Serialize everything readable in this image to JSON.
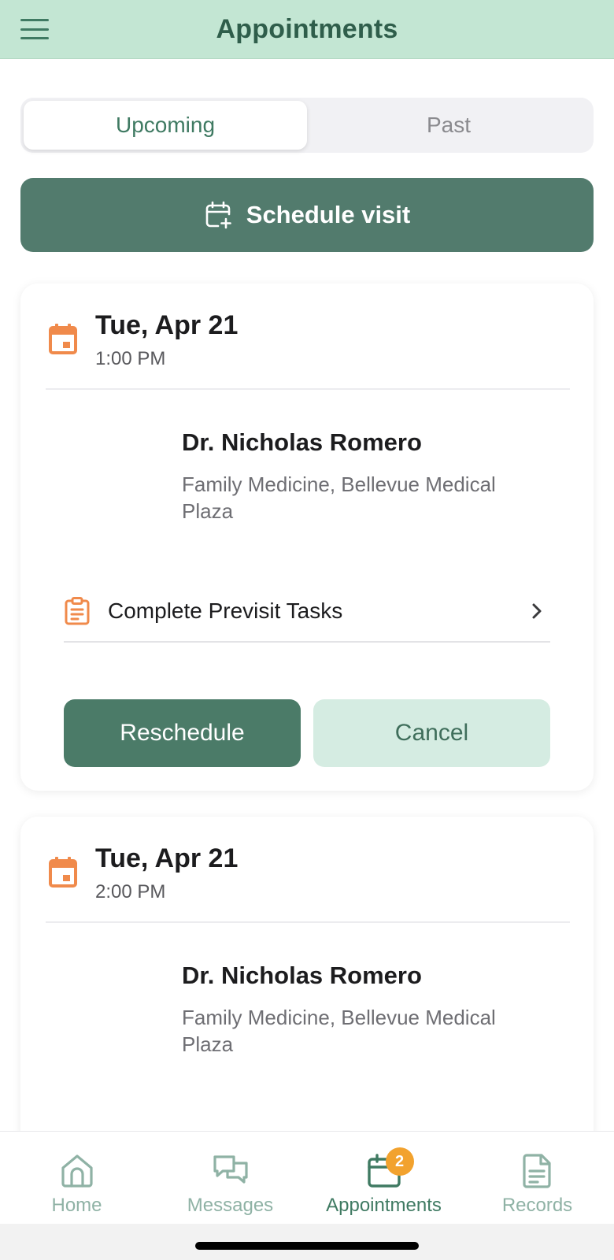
{
  "header": {
    "title": "Appointments"
  },
  "segments": {
    "upcoming": "Upcoming",
    "past": "Past"
  },
  "schedule_button": {
    "label": "Schedule visit"
  },
  "appointments": [
    {
      "date": "Tue, Apr 21",
      "time": "1:00 PM",
      "doctor": "Dr. Nicholas Romero",
      "location": "Family Medicine, Bellevue Medical Plaza",
      "task": "Complete Previsit Tasks",
      "reschedule": "Reschedule",
      "cancel": "Cancel"
    },
    {
      "date": "Tue, Apr 21",
      "time": "2:00 PM",
      "doctor": "Dr. Nicholas Romero",
      "location": "Family Medicine, Bellevue Medical Plaza"
    }
  ],
  "tabbar": {
    "home": "Home",
    "messages": "Messages",
    "appointments": "Appointments",
    "appointments_badge": "2",
    "records": "Records"
  },
  "colors": {
    "header_bg": "#c3e6d3",
    "primary_green": "#527b6d",
    "accent_orange": "#f08a4b",
    "badge_orange": "#f2a22e"
  },
  "icons": {
    "menu": "hamburger-menu-icon",
    "schedule": "calendar-plus-icon",
    "appointment": "calendar-icon",
    "task": "clipboard-icon",
    "chevron": "chevron-right-icon",
    "home": "home-icon",
    "messages": "chat-bubbles-icon",
    "appointments": "calendar-icon",
    "records": "document-icon"
  }
}
